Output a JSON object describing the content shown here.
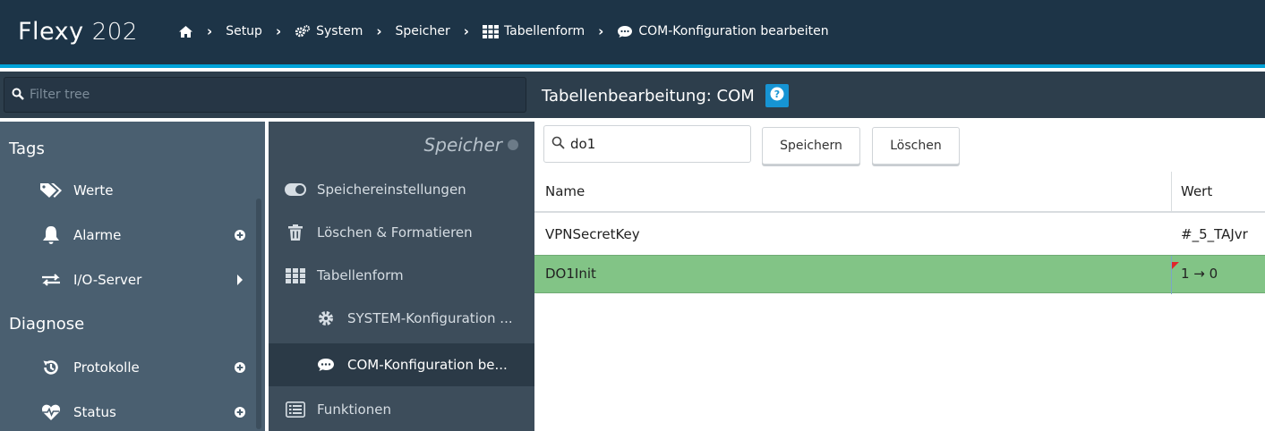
{
  "header": {
    "brand": "Flexy",
    "brand_version": "202",
    "breadcrumb": [
      {
        "label": "",
        "icon": "home-icon"
      },
      {
        "label": "Setup",
        "icon": ""
      },
      {
        "label": "System",
        "icon": "cogs-icon"
      },
      {
        "label": "Speicher",
        "icon": ""
      },
      {
        "label": "Tabellenform",
        "icon": "grid-icon"
      },
      {
        "label": "COM-Konfiguration bearbeiten",
        "icon": "comment-icon"
      }
    ],
    "bg_color": "#1d3447",
    "accent_color": "#00a3d9"
  },
  "filter": {
    "placeholder": "Filter tree"
  },
  "panel": {
    "title": "Tabellenbearbeitung: COM",
    "help_icon": "question-icon"
  },
  "sidebar": {
    "sections": [
      {
        "heading": "Tags",
        "items": [
          {
            "label": "Werte",
            "icon": "tags-icon",
            "action": ""
          },
          {
            "label": "Alarme",
            "icon": "bell-icon",
            "action": "plus-circle-icon"
          },
          {
            "label": "I/O-Server",
            "icon": "exchange-icon",
            "action": "caret-right-icon"
          }
        ]
      },
      {
        "heading": "Diagnose",
        "items": [
          {
            "label": "Protokolle",
            "icon": "history-icon",
            "action": "plus-circle-icon"
          },
          {
            "label": "Status",
            "icon": "heartbeat-icon",
            "action": "plus-circle-icon"
          }
        ]
      }
    ]
  },
  "middle": {
    "title": "Speicher",
    "items": [
      {
        "label": "Speichereinstellungen",
        "icon": "toggle-icon"
      },
      {
        "label": "Löschen & Formatieren",
        "icon": "trash-icon"
      },
      {
        "label": "Tabellenform",
        "icon": "grid-icon"
      },
      {
        "label": "SYSTEM-Konfiguration ...",
        "icon": "cog-icon"
      },
      {
        "label": "COM-Konfiguration be...",
        "icon": "comment-icon"
      },
      {
        "label": "Funktionen",
        "icon": "list-icon"
      }
    ]
  },
  "content": {
    "search_value": "do1",
    "save_label": "Speichern",
    "delete_label": "Löschen",
    "columns": [
      "Name",
      "Wert"
    ],
    "rows": [
      {
        "name": "VPNSecretKey",
        "value": "#_5_TAJvr"
      },
      {
        "name": "DO1Init",
        "value": "1 → 0"
      }
    ],
    "modified_row_color": "#82c486"
  }
}
